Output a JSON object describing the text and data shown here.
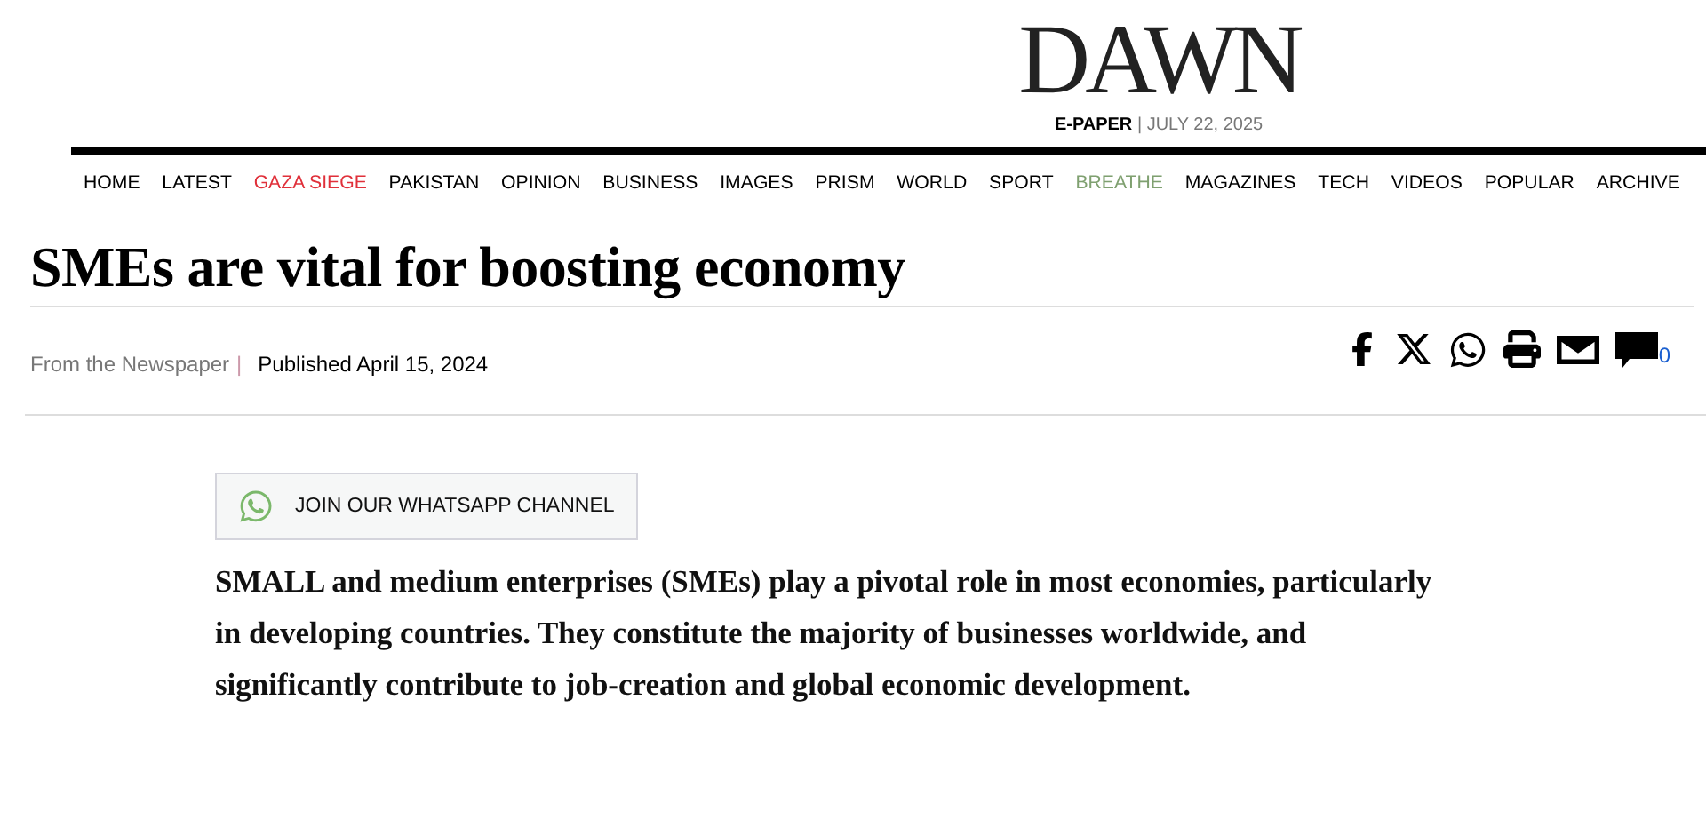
{
  "masthead": {
    "logo": "DAWN",
    "edition": "E-PAPER",
    "edition_separator": "|",
    "date": "JULY 22, 2025"
  },
  "nav": [
    {
      "label": "HOME",
      "color": "#000000"
    },
    {
      "label": "LATEST",
      "color": "#000000"
    },
    {
      "label": "GAZA SIEGE",
      "color": "#e0303a"
    },
    {
      "label": "PAKISTAN",
      "color": "#000000"
    },
    {
      "label": "OPINION",
      "color": "#000000"
    },
    {
      "label": "BUSINESS",
      "color": "#000000"
    },
    {
      "label": "IMAGES",
      "color": "#000000"
    },
    {
      "label": "PRISM",
      "color": "#000000"
    },
    {
      "label": "WORLD",
      "color": "#000000"
    },
    {
      "label": "SPORT",
      "color": "#000000"
    },
    {
      "label": "BREATHE",
      "color": "#7fa070"
    },
    {
      "label": "MAGAZINES",
      "color": "#000000"
    },
    {
      "label": "TECH",
      "color": "#000000"
    },
    {
      "label": "VIDEOS",
      "color": "#000000"
    },
    {
      "label": "POPULAR",
      "color": "#000000"
    },
    {
      "label": "ARCHIVE",
      "color": "#000000"
    }
  ],
  "article": {
    "headline": "SMEs are vital for boosting economy",
    "source": "From the Newspaper",
    "source_separator": "|",
    "published": "Published April 15, 2024",
    "comment_count": "0",
    "share": [
      {
        "kind": "facebook"
      },
      {
        "kind": "x"
      },
      {
        "kind": "whatsapp"
      },
      {
        "kind": "print"
      },
      {
        "kind": "email"
      }
    ],
    "whatsapp_button": "JOIN OUR WHATSAPP CHANNEL",
    "lead": "SMALL and medium enterprises (SMEs) play a pivotal role in most economies, particularly in developing countries. They constitute the majority of businesses worldwide, and significantly contribute to job-creation and global economic development."
  }
}
